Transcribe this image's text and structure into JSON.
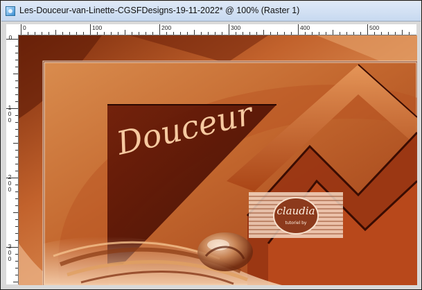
{
  "window": {
    "title": "Les-Douceur-van-Linette-CGSFDesigns-19-11-2022* @ 100% (Raster 1)",
    "app_icon": "paint-shop-pro-icon"
  },
  "rulers": {
    "horizontal_ticks": [
      "0",
      "100",
      "200",
      "300",
      "400",
      "500"
    ],
    "vertical_ticks": [
      "0",
      "100",
      "200",
      "300"
    ]
  },
  "image": {
    "title_text": "Douceur",
    "watermark_text": "claudia",
    "watermark_subtext": "tutoriel by",
    "colors": {
      "dark_red": "#5a1204",
      "rust": "#a8401a",
      "orange": "#d6783c",
      "peach": "#f3c79a",
      "text_peach": "#f6c9a0"
    }
  }
}
